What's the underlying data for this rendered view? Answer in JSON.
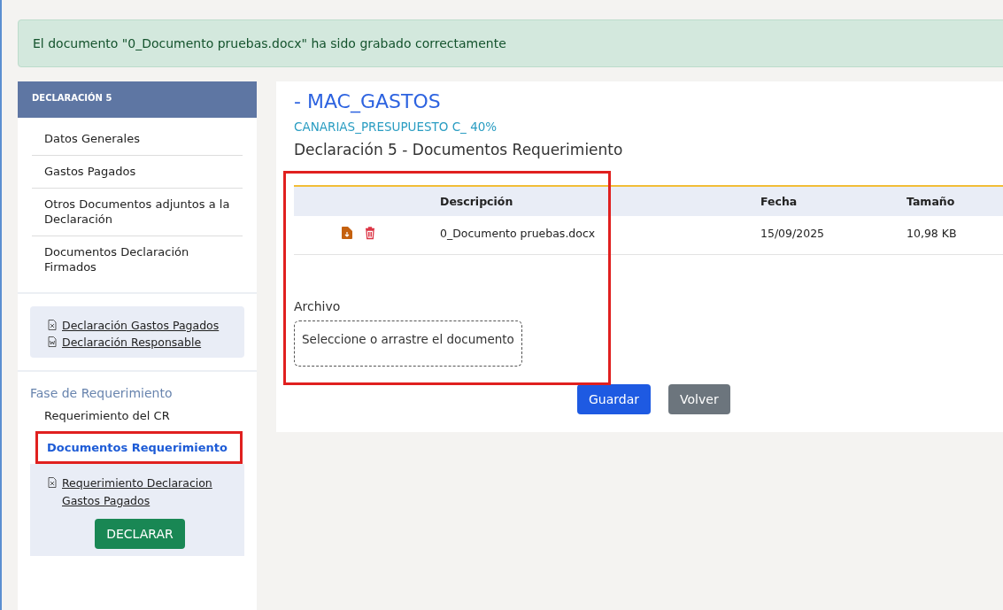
{
  "alert": {
    "message": "El documento \"0_Documento pruebas.docx\" ha sido grabado correctamente"
  },
  "sidebar": {
    "header": "DECLARACIÓN 5",
    "items": [
      {
        "label": "Datos Generales",
        "selected": false
      },
      {
        "label": "Gastos Pagados",
        "selected": false
      },
      {
        "label": "Otros Documentos adjuntos a la Declaración",
        "selected": false
      },
      {
        "label": "Documentos Declaración Firmados",
        "selected": false
      }
    ],
    "links": [
      {
        "label": "Declaración Gastos Pagados ",
        "kind": "excel"
      },
      {
        "label": "Declaración Responsable ",
        "kind": "word"
      }
    ],
    "phase_title": "Fase de Requerimiento",
    "phase_items": [
      {
        "label": "Requerimiento del CR",
        "selected": false
      },
      {
        "label": "Documentos Requerimiento",
        "selected": true
      }
    ],
    "phase_links": [
      {
        "label": "Requerimiento Declaracion Gastos Pagados ",
        "kind": "excel"
      }
    ],
    "declare_button": "DECLARAR"
  },
  "main": {
    "title": "- MAC_GASTOS",
    "subtitle": "CANARIAS_PRESUPUESTO C_ 40%",
    "heading": "Declaración 5 - Documentos Requerimiento",
    "table": {
      "columns": [
        "Descripción",
        "Fecha",
        "Tamaño"
      ],
      "rows": [
        {
          "description": "0_Documento pruebas.docx",
          "date": "15/09/2025",
          "size": "10,98 KB"
        }
      ]
    },
    "file_label": "Archivo",
    "dropzone": {
      "placeholder": "Seleccione o arrastre el documento"
    },
    "buttons": [
      {
        "label": "Guardar",
        "kind": "primary"
      },
      {
        "label": "Volver",
        "kind": "secondary"
      }
    ]
  }
}
